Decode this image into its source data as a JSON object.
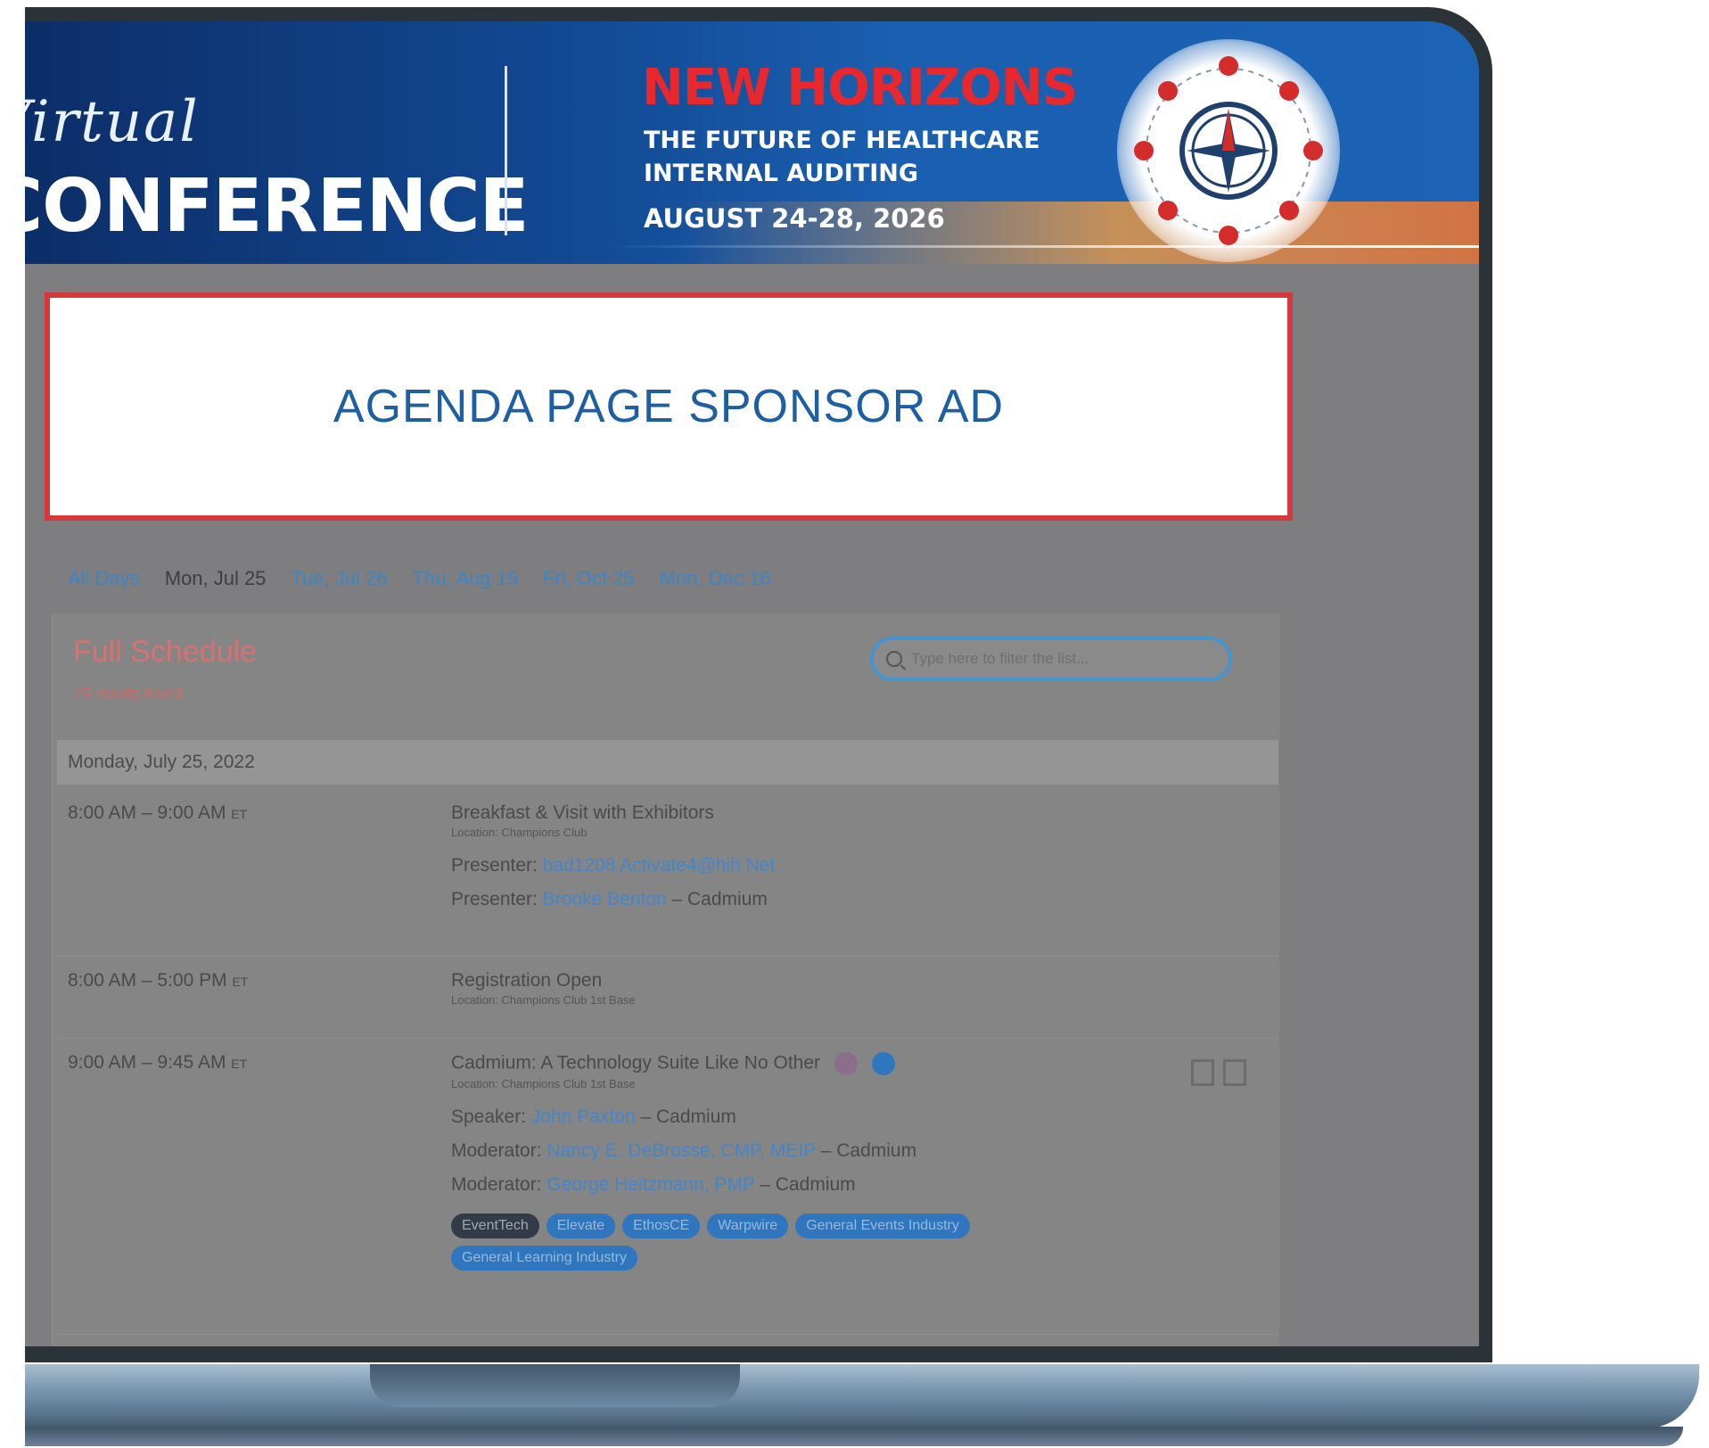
{
  "banner": {
    "virtual": "Virtual",
    "conference": "CONFERENCE",
    "headline": "NEW HORIZONS",
    "sub_line1": "THE FUTURE OF HEALTHCARE",
    "sub_line2": "INTERNAL AUDITING",
    "dates": "AUGUST 24-28, 2026"
  },
  "sponsor": {
    "text": "AGENDA PAGE SPONSOR AD"
  },
  "day_tabs": [
    "All Days",
    "Mon, Jul 25",
    "Tue, Jul 26",
    "Thu, Aug 19",
    "Fri, Oct 25",
    "Mon, Dec 16"
  ],
  "schedule": {
    "title": "Full Schedule",
    "results": "79 results found",
    "filter_placeholder": "Type here to filter the list...",
    "date_header": "Monday, July 25, 2022",
    "rows": [
      {
        "time": "8:00 AM – 9:00 AM",
        "tz": "ET",
        "title": "Breakfast & Visit with Exhibitors",
        "location": "Location: Champions Club",
        "people": [
          {
            "role": "Presenter:",
            "name": "bad1208 Activate4@hih Net",
            "org": ""
          },
          {
            "role": "Presenter:",
            "name": "Brooke Benton",
            "org": " – Cadmium"
          }
        ]
      },
      {
        "time": "8:00 AM – 5:00 PM",
        "tz": "ET",
        "title": "Registration Open",
        "location": "Location: Champions Club 1st Base"
      },
      {
        "time": "9:00 AM – 9:45 AM",
        "tz": "ET",
        "title": "Cadmium: A Technology Suite Like No Other",
        "location": "Location: Champions Club 1st Base",
        "people": [
          {
            "role": "Speaker:",
            "name": "John Paxton",
            "org": " – Cadmium"
          },
          {
            "role": "Moderator:",
            "name": "Nancy E. DeBrosse, CMP, MEIP",
            "org": " – Cadmium"
          },
          {
            "role": "Moderator:",
            "name": "George Heitzmann, PMP",
            "org": " – Cadmium"
          }
        ],
        "tags": [
          "EventTech",
          "Elevate",
          "EthosCE",
          "Warpwire",
          "General Events Industry",
          "General Learning Industry"
        ]
      }
    ]
  },
  "colors": {
    "accent_red": "#d6383d",
    "link_blue": "#1e5ea3",
    "banner_blue": "#134b96"
  }
}
